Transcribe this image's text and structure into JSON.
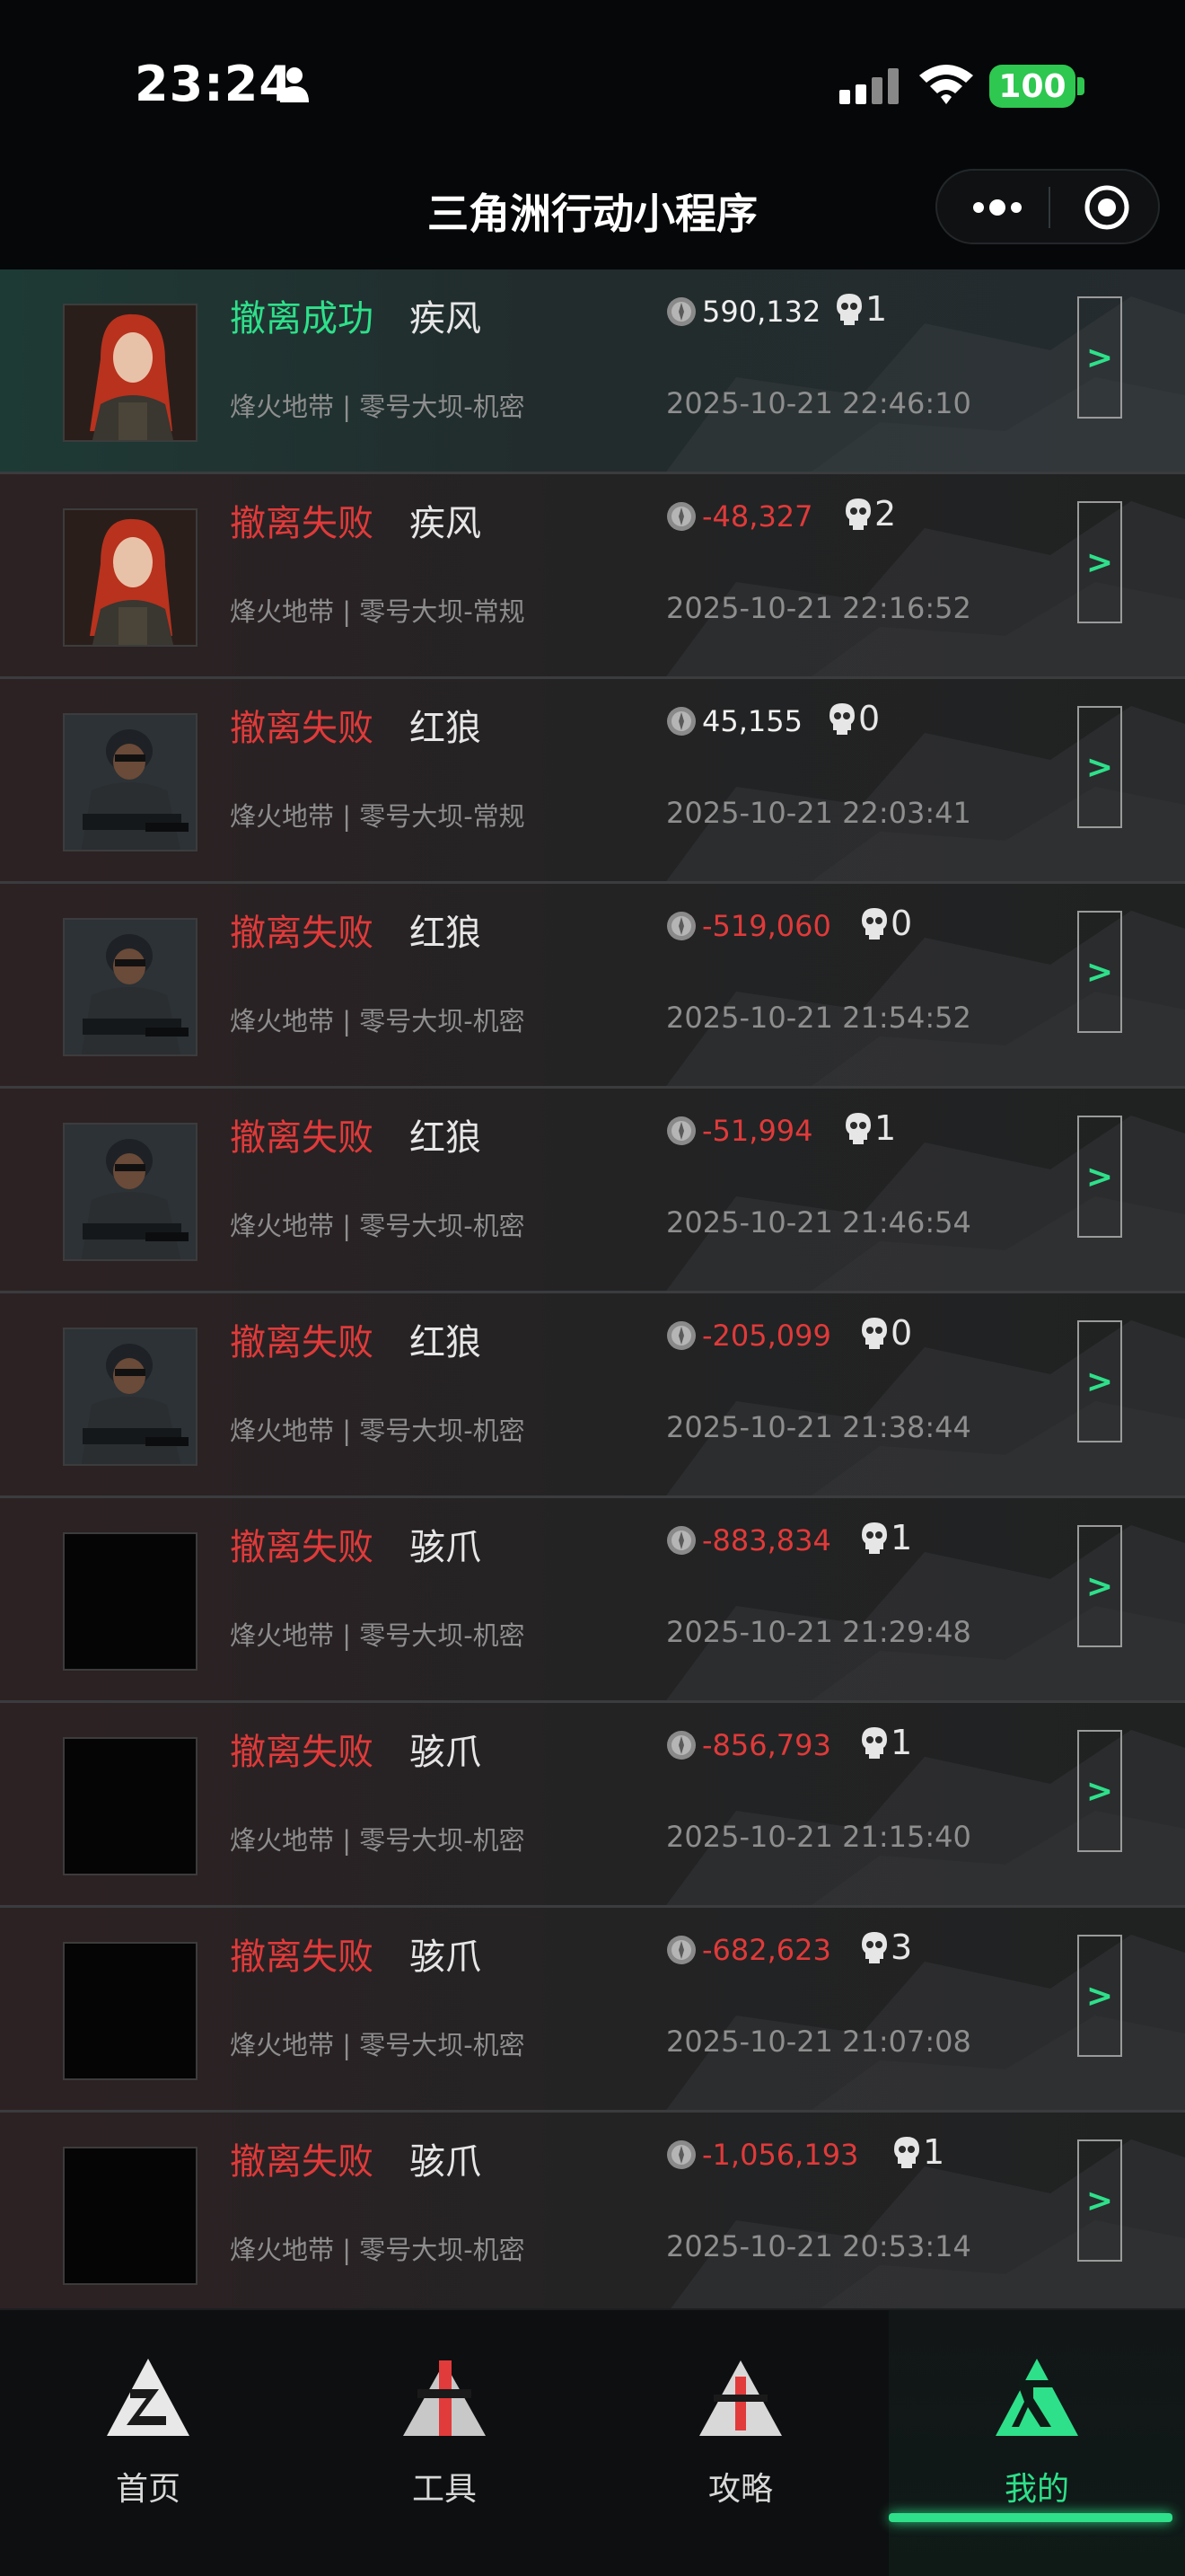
{
  "status_bar": {
    "time": "23:24",
    "battery": "100",
    "icons": [
      "person-icon",
      "signal-icon",
      "wifi-icon",
      "battery-icon"
    ]
  },
  "nav": {
    "title": "三角洲行动小程序",
    "icons": [
      "more-icon",
      "target-icon"
    ]
  },
  "colors": {
    "fail": "#e03a3a",
    "success": "#2ee08a",
    "accent": "#2ee08a",
    "battery": "#2ec750"
  },
  "records": [
    {
      "result": "撤离成功",
      "status": "success",
      "operator": "疾风",
      "mode": "烽火地带 | 零号大坝-机密",
      "value": "590,132",
      "kills": "1",
      "datetime": "2025-10-21 22:46:10",
      "avatar": "redhair",
      "arrow": ">"
    },
    {
      "result": "撤离失败",
      "status": "fail",
      "operator": "疾风",
      "mode": "烽火地带 | 零号大坝-常规",
      "value": "-48,327",
      "kills": "2",
      "datetime": "2025-10-21 22:16:52",
      "avatar": "redhair",
      "arrow": ">"
    },
    {
      "result": "撤离失败",
      "status": "fail",
      "operator": "红狼",
      "mode": "烽火地带 | 零号大坝-常规",
      "value": "45,155",
      "kills": "0",
      "datetime": "2025-10-21 22:03:41",
      "avatar": "soldier",
      "arrow": ">"
    },
    {
      "result": "撤离失败",
      "status": "fail",
      "operator": "红狼",
      "mode": "烽火地带 | 零号大坝-机密",
      "value": "-519,060",
      "kills": "0",
      "datetime": "2025-10-21 21:54:52",
      "avatar": "soldier",
      "arrow": ">"
    },
    {
      "result": "撤离失败",
      "status": "fail",
      "operator": "红狼",
      "mode": "烽火地带 | 零号大坝-机密",
      "value": "-51,994",
      "kills": "1",
      "datetime": "2025-10-21 21:46:54",
      "avatar": "soldier",
      "arrow": ">"
    },
    {
      "result": "撤离失败",
      "status": "fail",
      "operator": "红狼",
      "mode": "烽火地带 | 零号大坝-机密",
      "value": "-205,099",
      "kills": "0",
      "datetime": "2025-10-21 21:38:44",
      "avatar": "soldier",
      "arrow": ">"
    },
    {
      "result": "撤离失败",
      "status": "fail",
      "operator": "骇爪",
      "mode": "烽火地带 | 零号大坝-机密",
      "value": "-883,834",
      "kills": "1",
      "datetime": "2025-10-21 21:29:48",
      "avatar": "blank",
      "arrow": ">"
    },
    {
      "result": "撤离失败",
      "status": "fail",
      "operator": "骇爪",
      "mode": "烽火地带 | 零号大坝-机密",
      "value": "-856,793",
      "kills": "1",
      "datetime": "2025-10-21 21:15:40",
      "avatar": "blank",
      "arrow": ">"
    },
    {
      "result": "撤离失败",
      "status": "fail",
      "operator": "骇爪",
      "mode": "烽火地带 | 零号大坝-机密",
      "value": "-682,623",
      "kills": "3",
      "datetime": "2025-10-21 21:07:08",
      "avatar": "blank",
      "arrow": ">"
    },
    {
      "result": "撤离失败",
      "status": "fail",
      "operator": "骇爪",
      "mode": "烽火地带 | 零号大坝-机密",
      "value": "-1,056,193",
      "kills": "1",
      "datetime": "2025-10-21 20:53:14",
      "avatar": "blank",
      "arrow": ">"
    }
  ],
  "tabs": [
    {
      "label": "首页",
      "icon": "home-tab-icon",
      "active": false
    },
    {
      "label": "工具",
      "icon": "tools-tab-icon",
      "active": false
    },
    {
      "label": "攻略",
      "icon": "guide-tab-icon",
      "active": false
    },
    {
      "label": "我的",
      "icon": "profile-tab-icon",
      "active": true
    }
  ]
}
